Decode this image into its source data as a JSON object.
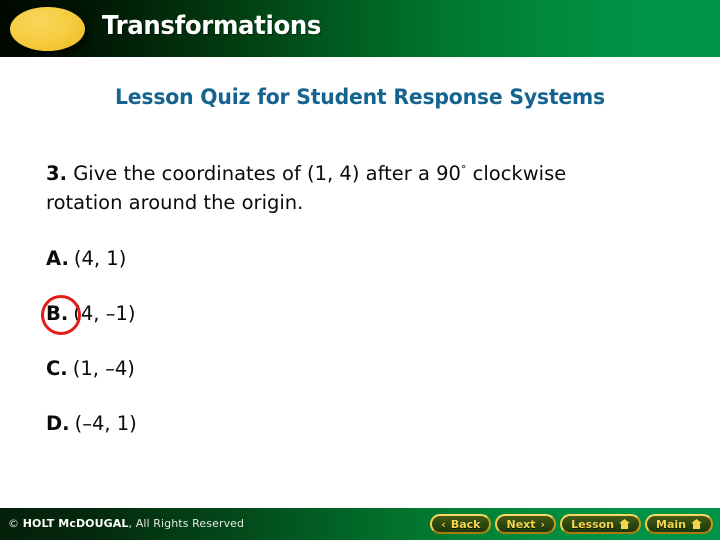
{
  "header": {
    "title": "Transformations",
    "bullet_icon": "ellipse-bullet",
    "accent_green": "#009246",
    "bullet_color": "#f5cb3c"
  },
  "slide": {
    "heading": "Lesson Quiz for Student Response Systems",
    "heading_color": "#156490",
    "question": {
      "number": "3.",
      "text_before_degree": "Give the coordinates of (1, 4) after a 90",
      "degree_symbol": "°",
      "text_after_degree": "clockwise rotation around the origin."
    },
    "choices": [
      {
        "letter": "A.",
        "text": "(4, 1)",
        "selected": false
      },
      {
        "letter": "B.",
        "text": "(4, –1)",
        "selected": true
      },
      {
        "letter": "C.",
        "text": "(1, –4)",
        "selected": false
      },
      {
        "letter": "D.",
        "text": "(–4, 1)",
        "selected": false
      }
    ],
    "answer_highlight_color": "#e21b1b"
  },
  "footer": {
    "copyright_symbol": "© ",
    "brand": "HOLT McDOUGAL",
    "rights": ", All Rights Reserved",
    "nav_buttons": [
      {
        "label": "Back",
        "icon": "chevron-left-icon",
        "glyph": "‹"
      },
      {
        "label": "Next",
        "icon": "chevron-right-icon",
        "glyph": "›"
      },
      {
        "label": "Lesson",
        "icon": "home-icon",
        "glyph": ""
      },
      {
        "label": "Main",
        "icon": "home-icon",
        "glyph": ""
      }
    ]
  }
}
